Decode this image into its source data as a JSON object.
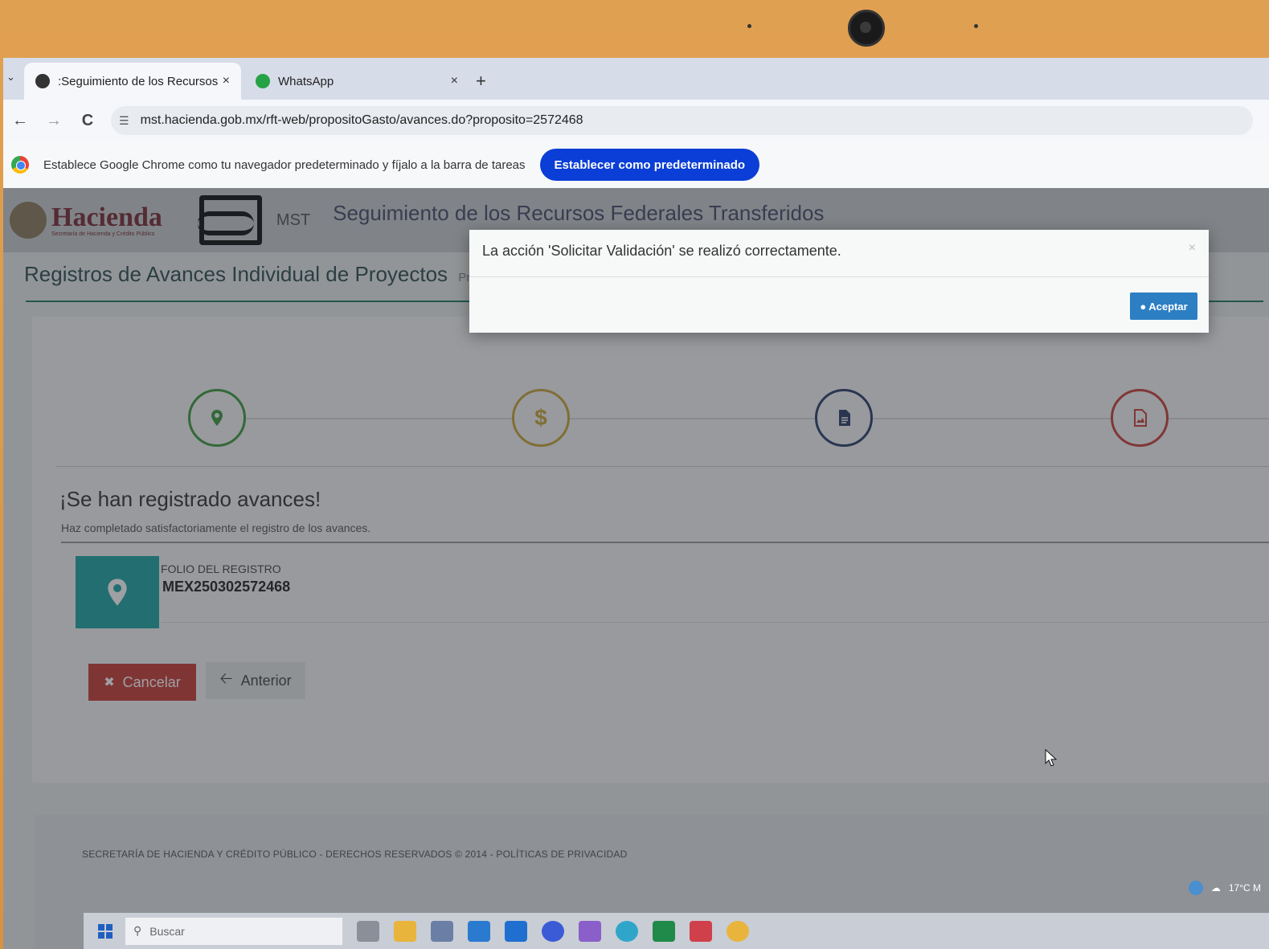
{
  "browser": {
    "tabs": [
      {
        "title": ":Seguimiento de los Recursos F",
        "close": "×",
        "active": true
      },
      {
        "title": "WhatsApp",
        "close": "×",
        "active": false
      }
    ],
    "new_tab": "+",
    "url": "mst.hacienda.gob.mx/rft-web/propositoGasto/avances.do?proposito=2572468",
    "nav": {
      "back": "←",
      "forward": "→",
      "reload": "C"
    }
  },
  "infobar": {
    "message": "Establece Google Chrome como tu navegador predeterminado y fíjalo a la barra de tareas",
    "button": "Establecer como predeterminado"
  },
  "header": {
    "brand": "Hacienda",
    "brand_sub": "Secretaría de Hacienda y Crédito Público",
    "mst": "MST",
    "app_title": "Seguimiento de los Recursos Federales Transferidos"
  },
  "page": {
    "title": "Registros de Avances Individual de Proyectos",
    "subtitle": "Propó"
  },
  "steps": {
    "colors": [
      "#3e9a3e",
      "#c9a43a",
      "#2c3e6b",
      "#c9403a"
    ],
    "icons": [
      "location-icon",
      "dollar-icon",
      "document-icon",
      "image-file-icon"
    ],
    "dollar": "$"
  },
  "success": {
    "title": "¡Se han registrado avances!",
    "subtitle": "Haz completado satisfactoriamente el registro de los avances."
  },
  "folio": {
    "label": "FOLIO DEL REGISTRO",
    "value": "MEX250302572468"
  },
  "buttons": {
    "cancel": "Cancelar",
    "previous": "Anterior"
  },
  "footer": {
    "text": "SECRETARÍA DE HACIENDA Y CRÉDITO PÚBLICO - DERECHOS RESERVADOS © 2014 - POLÍTICAS DE PRIVACIDAD"
  },
  "modal": {
    "message": "La acción 'Solicitar Validación' se realizó correctamente.",
    "close": "×",
    "button": "Aceptar"
  },
  "taskbar": {
    "search_placeholder": "Buscar",
    "weather": "17°C M"
  }
}
